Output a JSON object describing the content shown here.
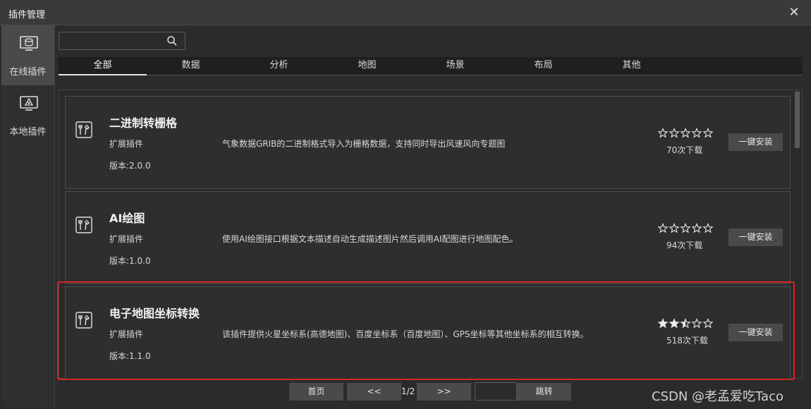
{
  "window": {
    "title": "插件管理",
    "close_glyph": "✕"
  },
  "nav": [
    {
      "label": "在线插件",
      "icon": "database-monitor-icon",
      "active": true
    },
    {
      "label": "本地插件",
      "icon": "local-monitor-icon",
      "active": false
    }
  ],
  "search": {
    "value": "",
    "placeholder": ""
  },
  "tabs": [
    {
      "label": "全部",
      "active": true
    },
    {
      "label": "数据",
      "active": false
    },
    {
      "label": "分析",
      "active": false
    },
    {
      "label": "地图",
      "active": false
    },
    {
      "label": "场景",
      "active": false
    },
    {
      "label": "布局",
      "active": false
    },
    {
      "label": "其他",
      "active": false
    }
  ],
  "plugins": [
    {
      "name": "二进制转栅格",
      "type": "扩展插件",
      "version": "版本:2.0.0",
      "description": "气象数据GRIB的二进制格式导入为栅格数据，支持同时导出风速风向专题图",
      "rating": 0,
      "downloads": "70次下载",
      "install_label": "一键安装"
    },
    {
      "name": "AI绘图",
      "type": "扩展插件",
      "version": "版本:1.0.0",
      "description": "使用AI绘图接口根据文本描述自动生成描述图片然后调用AI配图进行地图配色。",
      "rating": 0,
      "downloads": "94次下载",
      "install_label": "一键安装"
    },
    {
      "name": "电子地图坐标转换",
      "type": "扩展插件",
      "version": "版本:1.1.0",
      "description": "该插件提供火星坐标系(高德地图)、百度坐标系（百度地图）、GPS坐标等其他坐标系的相互转换。",
      "rating": 2.5,
      "downloads": "518次下载",
      "install_label": "一键安装"
    }
  ],
  "pagination": {
    "first": "首页",
    "prev": "<<",
    "info": "1/2",
    "next": ">>",
    "jump_value": "",
    "jump": "跳转"
  },
  "watermark": "CSDN @老孟爱吃Taco",
  "colors": {
    "background": "#2b2b2b",
    "highlight": "#d9251f",
    "button": "#4a4a4a"
  }
}
